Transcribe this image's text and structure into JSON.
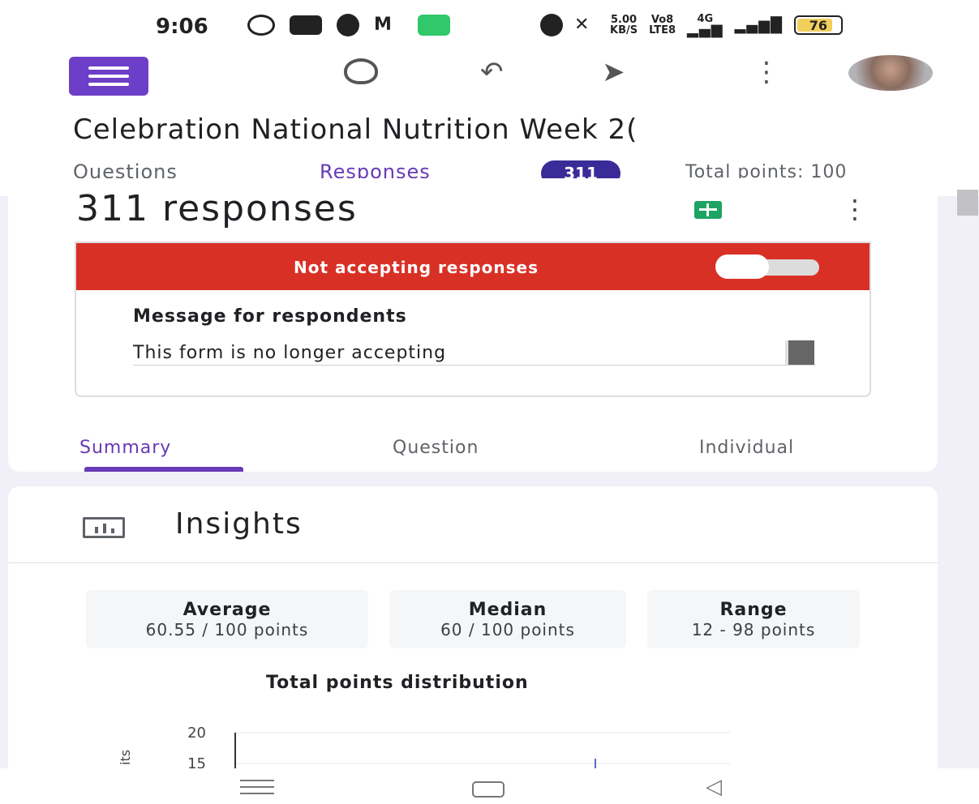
{
  "status_bar": {
    "time": "9:06",
    "net_speed_value": "5.00",
    "net_speed_unit": "KB/S",
    "volte": "Vo8",
    "volte_sub": "LTE8",
    "network": "4G",
    "battery": "76",
    "left_icons": [
      "whatsapp-icon",
      "youtube-icon",
      "chrome-icon",
      "gmail-icon",
      "phone-app-icon"
    ],
    "right_icons": [
      "alarm-icon",
      "mute-icon",
      "signal-icon",
      "battery-icon"
    ]
  },
  "toolbar": {
    "icons": [
      "palette-icon",
      "undo-icon",
      "send-icon",
      "more-vert-icon"
    ]
  },
  "form": {
    "title": "Celebration National Nutrition Week 2("
  },
  "tabs": {
    "questions": "Questions",
    "responses": "Responses",
    "responses_badge": "311",
    "total_points": "Total points: 100"
  },
  "responses": {
    "count_heading": "311 responses",
    "banner_text": "Not accepting responses",
    "accepting": false,
    "message_label": "Message for respondents",
    "message_value": "This form is no longer accepting"
  },
  "view_tabs": {
    "summary": "Summary",
    "question": "Question",
    "individual": "Individual",
    "active": "summary"
  },
  "insights": {
    "title": "Insights",
    "stats": {
      "average_label": "Average",
      "average_value": "60.55 / 100 points",
      "median_label": "Median",
      "median_value": "60 / 100 points",
      "range_label": "Range",
      "range_value": "12 - 98 points"
    }
  },
  "chart_data": {
    "type": "bar",
    "title": "Total points distribution",
    "ylabel": "its",
    "y_ticks": [
      "20",
      "15"
    ],
    "ylim": [
      0,
      20
    ],
    "grid": true,
    "categories": [],
    "values": []
  },
  "nav": {
    "icons": [
      "recent-apps-icon",
      "home-icon",
      "back-icon"
    ]
  }
}
